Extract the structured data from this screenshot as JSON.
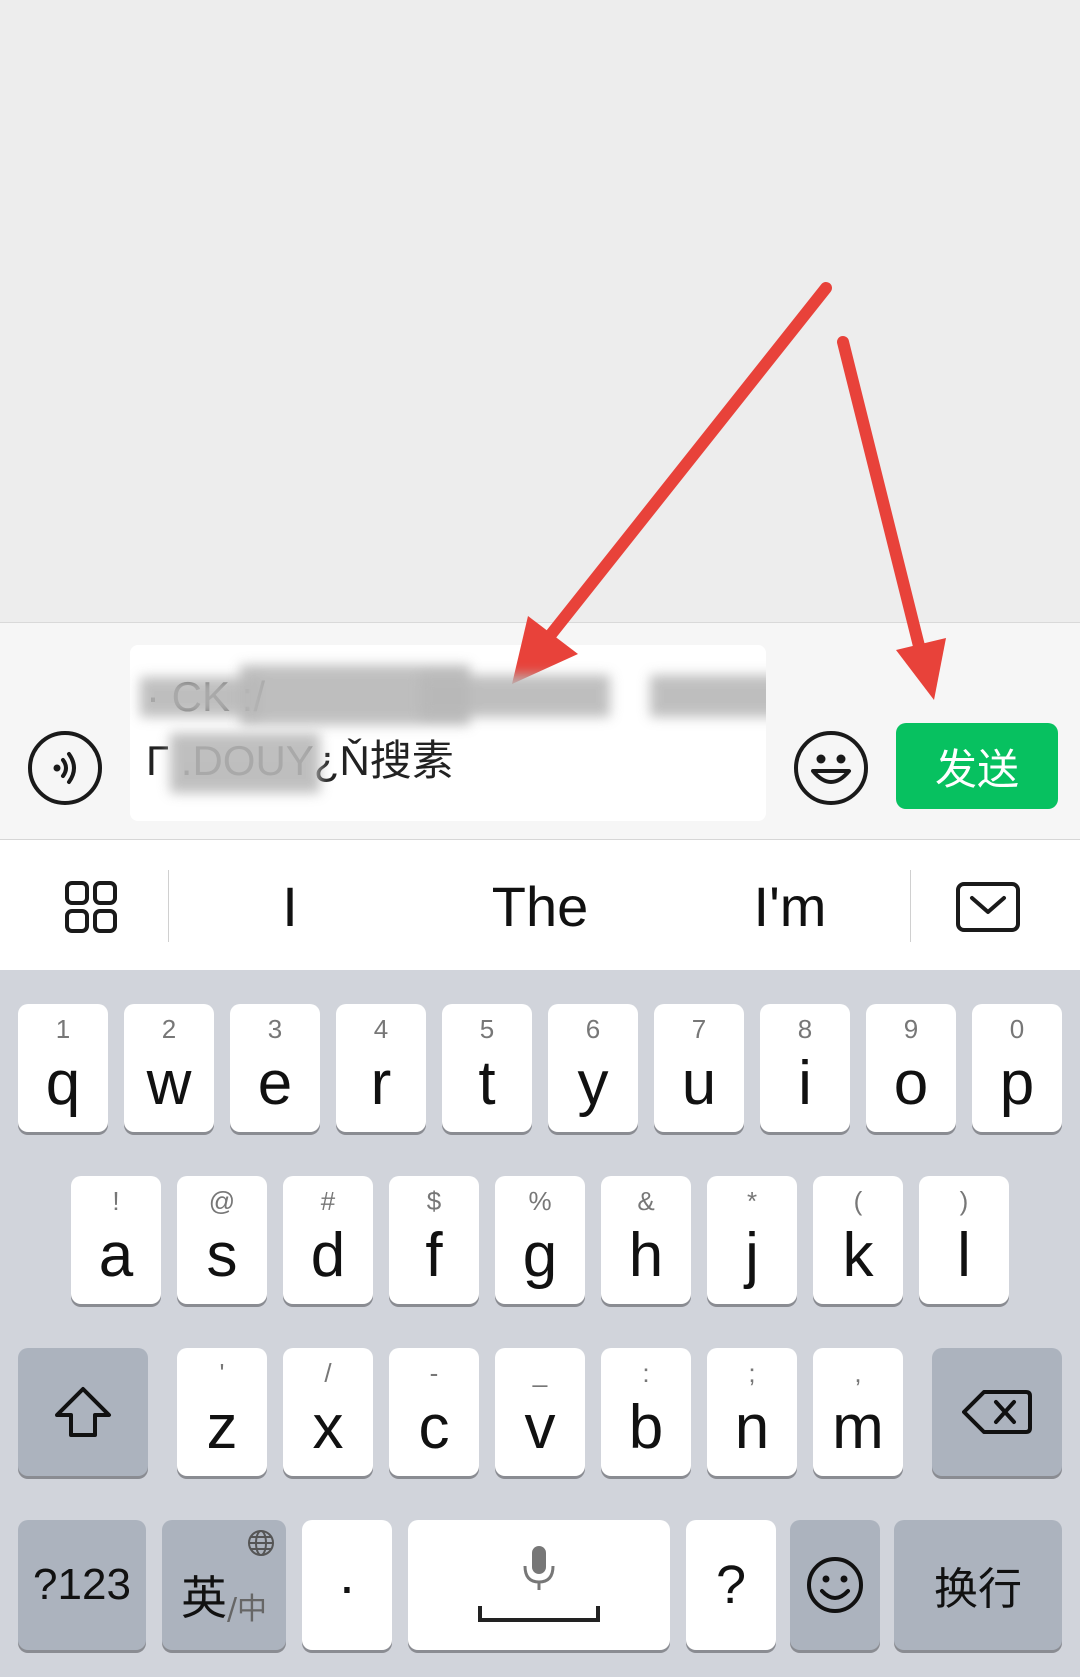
{
  "input": {
    "line1_visible": "       ·                    CK                 :/",
    "line2_visible": "Γ    .DOUY¿Ň搜素",
    "send_label": "发送"
  },
  "suggestions": [
    "I",
    "The",
    "I'm"
  ],
  "keyboard": {
    "row1": [
      {
        "hint": "1",
        "key": "q"
      },
      {
        "hint": "2",
        "key": "w"
      },
      {
        "hint": "3",
        "key": "e"
      },
      {
        "hint": "4",
        "key": "r"
      },
      {
        "hint": "5",
        "key": "t"
      },
      {
        "hint": "6",
        "key": "y"
      },
      {
        "hint": "7",
        "key": "u"
      },
      {
        "hint": "8",
        "key": "i"
      },
      {
        "hint": "9",
        "key": "o"
      },
      {
        "hint": "0",
        "key": "p"
      }
    ],
    "row2": [
      {
        "hint": "!",
        "key": "a"
      },
      {
        "hint": "@",
        "key": "s"
      },
      {
        "hint": "#",
        "key": "d"
      },
      {
        "hint": "$",
        "key": "f"
      },
      {
        "hint": "%",
        "key": "g"
      },
      {
        "hint": "&",
        "key": "h"
      },
      {
        "hint": "*",
        "key": "j"
      },
      {
        "hint": "(",
        "key": "k"
      },
      {
        "hint": ")",
        "key": "l"
      }
    ],
    "row3": [
      {
        "hint": "'",
        "key": "z"
      },
      {
        "hint": "/",
        "key": "x"
      },
      {
        "hint": "-",
        "key": "c"
      },
      {
        "hint": "_",
        "key": "v"
      },
      {
        "hint": ":",
        "key": "b"
      },
      {
        "hint": ";",
        "key": "n"
      },
      {
        "hint": ",",
        "key": "m"
      }
    ],
    "num_label": "?123",
    "lang_main": "英",
    "lang_sub": "/中",
    "dot_label": "·",
    "question_label": "?",
    "return_label": "换行"
  },
  "colors": {
    "send_button": "#07c160",
    "annotation_arrow": "#e8423a",
    "keyboard_bg": "#d1d4db"
  },
  "icons": {
    "voice": "voice-icon",
    "emoji": "emoji-icon",
    "apps_grid": "grid-icon",
    "hide_keyboard": "hide-keyboard-icon",
    "shift": "shift-icon",
    "backspace": "backspace-icon",
    "globe": "globe-icon",
    "mic": "mic-icon",
    "emoji_key": "emoji-key-icon"
  }
}
